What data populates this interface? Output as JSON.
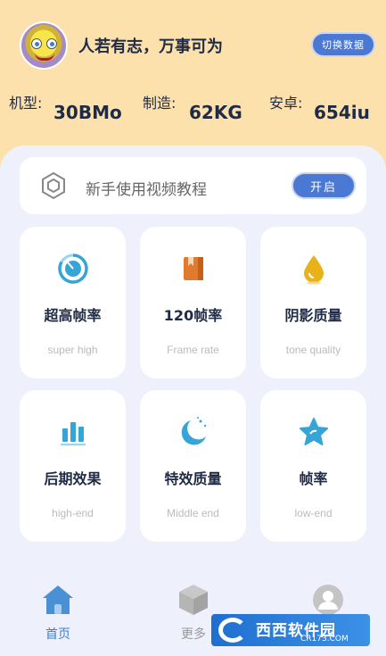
{
  "profile": {
    "motto": "人若有志，万事可为",
    "switch_label": "切换数据"
  },
  "stats": [
    {
      "label": "机型:",
      "value": "30BMo"
    },
    {
      "label": "制造:",
      "value": "62KG"
    },
    {
      "label": "安卓:",
      "value": "654iu"
    }
  ],
  "tutorial": {
    "text": "新手使用视频教程",
    "button_label": "开启"
  },
  "cards": [
    {
      "title": "超高帧率",
      "subtitle": "super high",
      "icon": "timer-icon"
    },
    {
      "title": "120帧率",
      "subtitle": "Frame rate",
      "icon": "book-icon"
    },
    {
      "title": "阴影质量",
      "subtitle": "tone quality",
      "icon": "droplet-icon"
    },
    {
      "title": "后期效果",
      "subtitle": "high-end",
      "icon": "bar-chart-icon"
    },
    {
      "title": "特效质量",
      "subtitle": "Middle end",
      "icon": "moon-icon"
    },
    {
      "title": "帧率",
      "subtitle": "low-end",
      "icon": "star-icon"
    }
  ],
  "tabbar": {
    "home": "首页",
    "more": "更多"
  },
  "watermark": {
    "text": "西西软件园",
    "sub": "CR173.COM"
  },
  "colors": {
    "header_bg": "#fde1ad",
    "panel_bg": "#eef1fb",
    "accent_blue": "#4a78d3",
    "icon_blue": "#35a5d8",
    "icon_orange": "#e07a2e",
    "icon_yellow": "#e8b318"
  }
}
